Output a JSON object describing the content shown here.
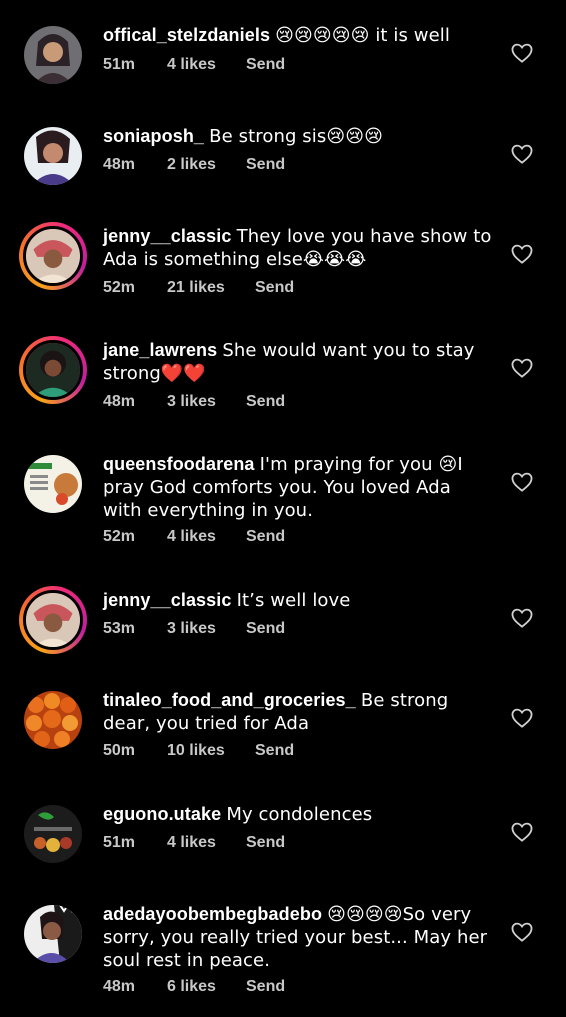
{
  "comments": [
    {
      "username": "offical_stelzdaniels",
      "text": "😢😢😢😢😢 it is well",
      "time": "51m",
      "likes": "4 likes",
      "reply": "Send",
      "avatar": "person-photo-icon"
    },
    {
      "username": "soniaposh_",
      "text": "Be strong sis😢😢😢",
      "time": "48m",
      "likes": "2 likes",
      "reply": "Send",
      "avatar": "person-photo-icon"
    },
    {
      "username": "jenny__classic",
      "text": "They love you have show to Ada is something else😭😭😭",
      "time": "52m",
      "likes": "21 likes",
      "reply": "Send",
      "avatar": "person-photo-icon",
      "story": true
    },
    {
      "username": "jane_lawrens",
      "text": "She would want you to stay strong❤️❤️",
      "time": "48m",
      "likes": "3 likes",
      "reply": "Send",
      "avatar": "person-photo-icon",
      "story": true
    },
    {
      "username": "queensfoodarena",
      "text": "I'm praying for you 😢I pray God comforts you. You loved Ada with everything in you.",
      "time": "52m",
      "likes": "4 likes",
      "reply": "Send",
      "avatar": "food-flyer-icon"
    },
    {
      "username": "jenny__classic",
      "text": "It’s well love",
      "time": "53m",
      "likes": "3 likes",
      "reply": "Send",
      "avatar": "person-photo-icon",
      "story": true
    },
    {
      "username": "tinaleo_food_and_groceries_",
      "text": "Be strong dear, you tried for Ada",
      "time": "50m",
      "likes": "10 likes",
      "reply": "Send",
      "avatar": "tomatoes-photo-icon"
    },
    {
      "username": "eguono.utake",
      "text": "My condolences",
      "time": "51m",
      "likes": "4 likes",
      "reply": "Send",
      "avatar": "food-logo-icon"
    },
    {
      "username": "adedayoobembegbadebo",
      "text": "😢😢😢😢So very sorry, you really tried your best... May her soul rest in peace.",
      "time": "48m",
      "likes": "6 likes",
      "reply": "Send",
      "avatar": "person-photo-icon"
    }
  ],
  "colors": {
    "background": "#000000",
    "text": "#ffffff",
    "meta": "#c8c8c8",
    "story_ring": "#ee2a7b"
  }
}
